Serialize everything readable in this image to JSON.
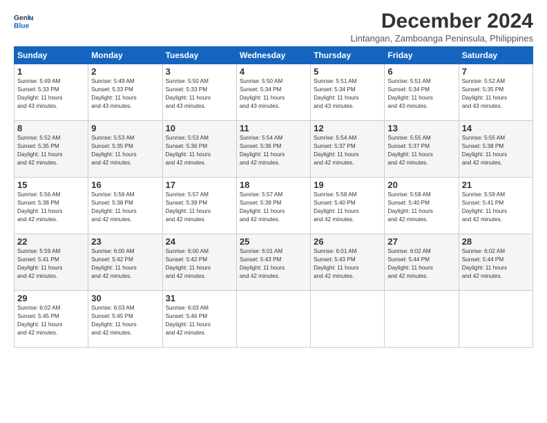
{
  "logo": {
    "line1": "General",
    "line2": "Blue"
  },
  "title": "December 2024",
  "location": "Lintangan, Zamboanga Peninsula, Philippines",
  "days_of_week": [
    "Sunday",
    "Monday",
    "Tuesday",
    "Wednesday",
    "Thursday",
    "Friday",
    "Saturday"
  ],
  "weeks": [
    [
      {
        "day": "1",
        "sunrise": "5:49 AM",
        "sunset": "5:33 PM",
        "daylight": "11 hours and 43 minutes."
      },
      {
        "day": "2",
        "sunrise": "5:49 AM",
        "sunset": "5:33 PM",
        "daylight": "11 hours and 43 minutes."
      },
      {
        "day": "3",
        "sunrise": "5:50 AM",
        "sunset": "5:33 PM",
        "daylight": "11 hours and 43 minutes."
      },
      {
        "day": "4",
        "sunrise": "5:50 AM",
        "sunset": "5:34 PM",
        "daylight": "11 hours and 43 minutes."
      },
      {
        "day": "5",
        "sunrise": "5:51 AM",
        "sunset": "5:34 PM",
        "daylight": "11 hours and 43 minutes."
      },
      {
        "day": "6",
        "sunrise": "5:51 AM",
        "sunset": "5:34 PM",
        "daylight": "11 hours and 43 minutes."
      },
      {
        "day": "7",
        "sunrise": "5:52 AM",
        "sunset": "5:35 PM",
        "daylight": "11 hours and 43 minutes."
      }
    ],
    [
      {
        "day": "8",
        "sunrise": "5:52 AM",
        "sunset": "5:35 PM",
        "daylight": "11 hours and 42 minutes."
      },
      {
        "day": "9",
        "sunrise": "5:53 AM",
        "sunset": "5:35 PM",
        "daylight": "11 hours and 42 minutes."
      },
      {
        "day": "10",
        "sunrise": "5:53 AM",
        "sunset": "5:36 PM",
        "daylight": "11 hours and 42 minutes."
      },
      {
        "day": "11",
        "sunrise": "5:54 AM",
        "sunset": "5:36 PM",
        "daylight": "11 hours and 42 minutes."
      },
      {
        "day": "12",
        "sunrise": "5:54 AM",
        "sunset": "5:37 PM",
        "daylight": "11 hours and 42 minutes."
      },
      {
        "day": "13",
        "sunrise": "5:55 AM",
        "sunset": "5:37 PM",
        "daylight": "11 hours and 42 minutes."
      },
      {
        "day": "14",
        "sunrise": "5:55 AM",
        "sunset": "5:38 PM",
        "daylight": "11 hours and 42 minutes."
      }
    ],
    [
      {
        "day": "15",
        "sunrise": "5:56 AM",
        "sunset": "5:38 PM",
        "daylight": "11 hours and 42 minutes."
      },
      {
        "day": "16",
        "sunrise": "5:56 AM",
        "sunset": "5:38 PM",
        "daylight": "11 hours and 42 minutes."
      },
      {
        "day": "17",
        "sunrise": "5:57 AM",
        "sunset": "5:39 PM",
        "daylight": "11 hours and 42 minutes."
      },
      {
        "day": "18",
        "sunrise": "5:57 AM",
        "sunset": "5:39 PM",
        "daylight": "11 hours and 42 minutes."
      },
      {
        "day": "19",
        "sunrise": "5:58 AM",
        "sunset": "5:40 PM",
        "daylight": "11 hours and 42 minutes."
      },
      {
        "day": "20",
        "sunrise": "5:58 AM",
        "sunset": "5:40 PM",
        "daylight": "11 hours and 42 minutes."
      },
      {
        "day": "21",
        "sunrise": "5:59 AM",
        "sunset": "5:41 PM",
        "daylight": "11 hours and 42 minutes."
      }
    ],
    [
      {
        "day": "22",
        "sunrise": "5:59 AM",
        "sunset": "5:41 PM",
        "daylight": "11 hours and 42 minutes."
      },
      {
        "day": "23",
        "sunrise": "6:00 AM",
        "sunset": "5:42 PM",
        "daylight": "11 hours and 42 minutes."
      },
      {
        "day": "24",
        "sunrise": "6:00 AM",
        "sunset": "5:42 PM",
        "daylight": "11 hours and 42 minutes."
      },
      {
        "day": "25",
        "sunrise": "6:01 AM",
        "sunset": "5:43 PM",
        "daylight": "11 hours and 42 minutes."
      },
      {
        "day": "26",
        "sunrise": "6:01 AM",
        "sunset": "5:43 PM",
        "daylight": "11 hours and 42 minutes."
      },
      {
        "day": "27",
        "sunrise": "6:02 AM",
        "sunset": "5:44 PM",
        "daylight": "11 hours and 42 minutes."
      },
      {
        "day": "28",
        "sunrise": "6:02 AM",
        "sunset": "5:44 PM",
        "daylight": "11 hours and 42 minutes."
      }
    ],
    [
      {
        "day": "29",
        "sunrise": "6:02 AM",
        "sunset": "5:45 PM",
        "daylight": "11 hours and 42 minutes."
      },
      {
        "day": "30",
        "sunrise": "6:03 AM",
        "sunset": "5:45 PM",
        "daylight": "11 hours and 42 minutes."
      },
      {
        "day": "31",
        "sunrise": "6:03 AM",
        "sunset": "5:46 PM",
        "daylight": "11 hours and 42 minutes."
      },
      null,
      null,
      null,
      null
    ]
  ]
}
